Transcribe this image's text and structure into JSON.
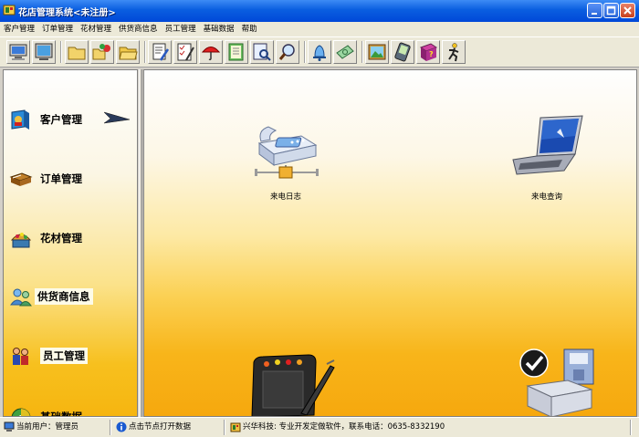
{
  "window": {
    "title": "花店管理系统<未注册>"
  },
  "menu": {
    "items": [
      "客户管理",
      "订单管理",
      "花材管理",
      "供货商信息",
      "员工管理",
      "基础数据",
      "帮助"
    ]
  },
  "toolbar": {
    "icons": [
      "computer-icon",
      "monitor-icon",
      "folder-icon",
      "folder-exchange-icon",
      "folder-open-icon",
      "document-pen-icon",
      "checklist-icon",
      "umbrella-icon",
      "notebook-icon",
      "search-document-icon",
      "magnifier-icon",
      "bell-icon",
      "money-icon",
      "picture-icon",
      "pda-icon",
      "help-book-icon",
      "exit-runner-icon"
    ]
  },
  "sidebar": {
    "items": [
      {
        "label": "客户管理",
        "icon": "customer-book-icon"
      },
      {
        "label": "订单管理",
        "icon": "order-book-icon"
      },
      {
        "label": "花材管理",
        "icon": "flower-basket-icon"
      },
      {
        "label": "供货商信息",
        "icon": "supplier-people-icon"
      },
      {
        "label": "员工管理",
        "icon": "staff-icon"
      },
      {
        "label": "基础数据",
        "icon": "data-disc-icon"
      }
    ]
  },
  "desktop": {
    "items": [
      {
        "label": "来电日志",
        "icon": "fax-network-icon"
      },
      {
        "label": "来电查询",
        "icon": "laptop-icon"
      }
    ]
  },
  "statusbar": {
    "user": "当前用户：管理员",
    "hint": "点击节点打开数据",
    "company": "兴华科技: 专业开发定做软件，联系电话：0635-8332190"
  },
  "colors": {
    "title_blue": "#0a5ee0",
    "panel_gold": "#f6b510"
  }
}
